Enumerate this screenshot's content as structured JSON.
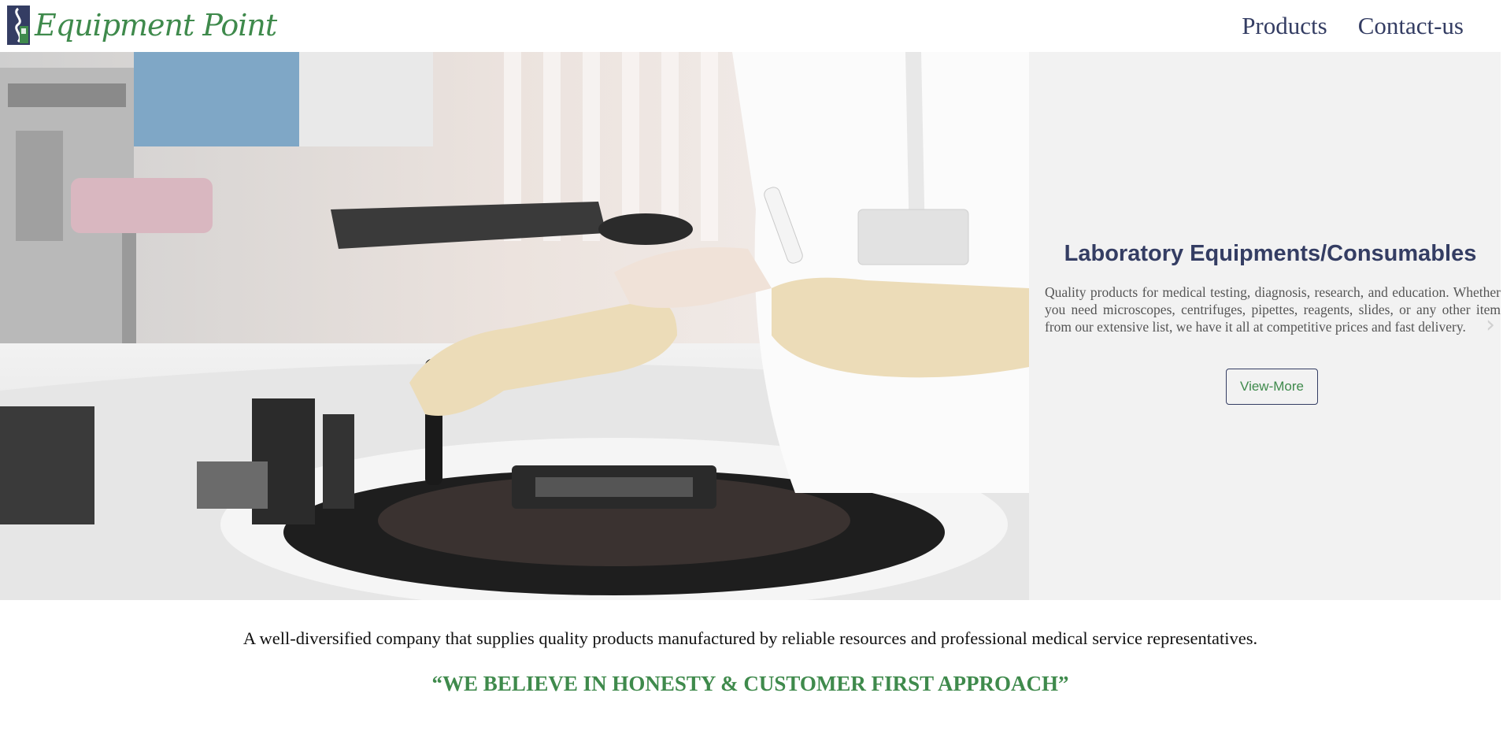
{
  "header": {
    "brand": "Equipment Point",
    "nav": [
      {
        "label": "Products"
      },
      {
        "label": "Contact-us"
      }
    ]
  },
  "hero": {
    "image_icon": "lab-technician-photo",
    "title": "Laboratory Equipments/Consumables",
    "description": "Quality products for medical testing, diagnosis, research, and education. Whether you need microscopes, centrifuges, pipettes, reagents, slides, or any other item from our extensive list, we have it all at competitive prices and fast delivery.",
    "button_label": "View-More",
    "next_icon": "chevron-right-icon",
    "next_glyph": "›"
  },
  "intro": {
    "text": "A well-diversified company that supplies quality products manufactured by reliable resources and professional medical service representatives.",
    "motto": "“WE BELIEVE IN HONESTY & CUSTOMER FIRST APPROACH”"
  },
  "colors": {
    "brand_green": "#3f8a4c",
    "brand_navy": "#343d63",
    "panel_bg": "#f2f2f2"
  }
}
